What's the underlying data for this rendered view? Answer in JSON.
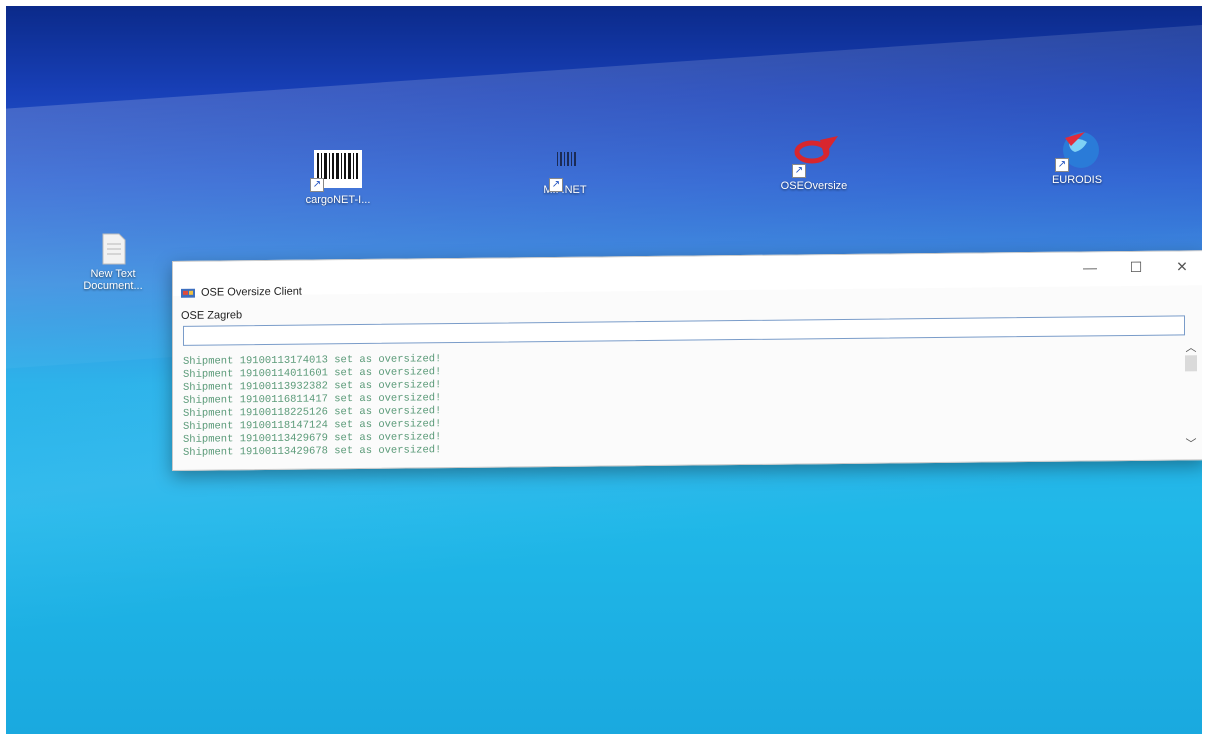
{
  "desktop": {
    "icons": [
      {
        "label": "cargoNET-I...",
        "icon": "barcode-icon"
      },
      {
        "label": "MIP.NET",
        "icon": "barcode-icon"
      },
      {
        "label": "OSEOversize",
        "icon": "ose-logo-icon"
      },
      {
        "label": "EURODIS",
        "icon": "globe-icon"
      },
      {
        "label": "New Text Document...",
        "icon": "text-document-icon"
      }
    ]
  },
  "window": {
    "title": "OSE Oversize Client",
    "menu_label": "OSE Zagreb",
    "input_value": "",
    "log_lines": [
      "Shipment 19100113174013 set as oversized!",
      "Shipment 19100114011601 set as oversized!",
      "Shipment 19100113932382 set as oversized!",
      "Shipment 19100116811417 set as oversized!",
      "Shipment 19100118225126 set as oversized!",
      "Shipment 19100118147124 set as oversized!",
      "Shipment 19100113429679 set as oversized!",
      "Shipment 19100113429678 set as oversized!"
    ],
    "controls": {
      "minimize": "—",
      "maximize": "☐",
      "close": "✕"
    }
  },
  "colors": {
    "log_text": "#5a9a78",
    "input_border": "#7a9cc9"
  }
}
